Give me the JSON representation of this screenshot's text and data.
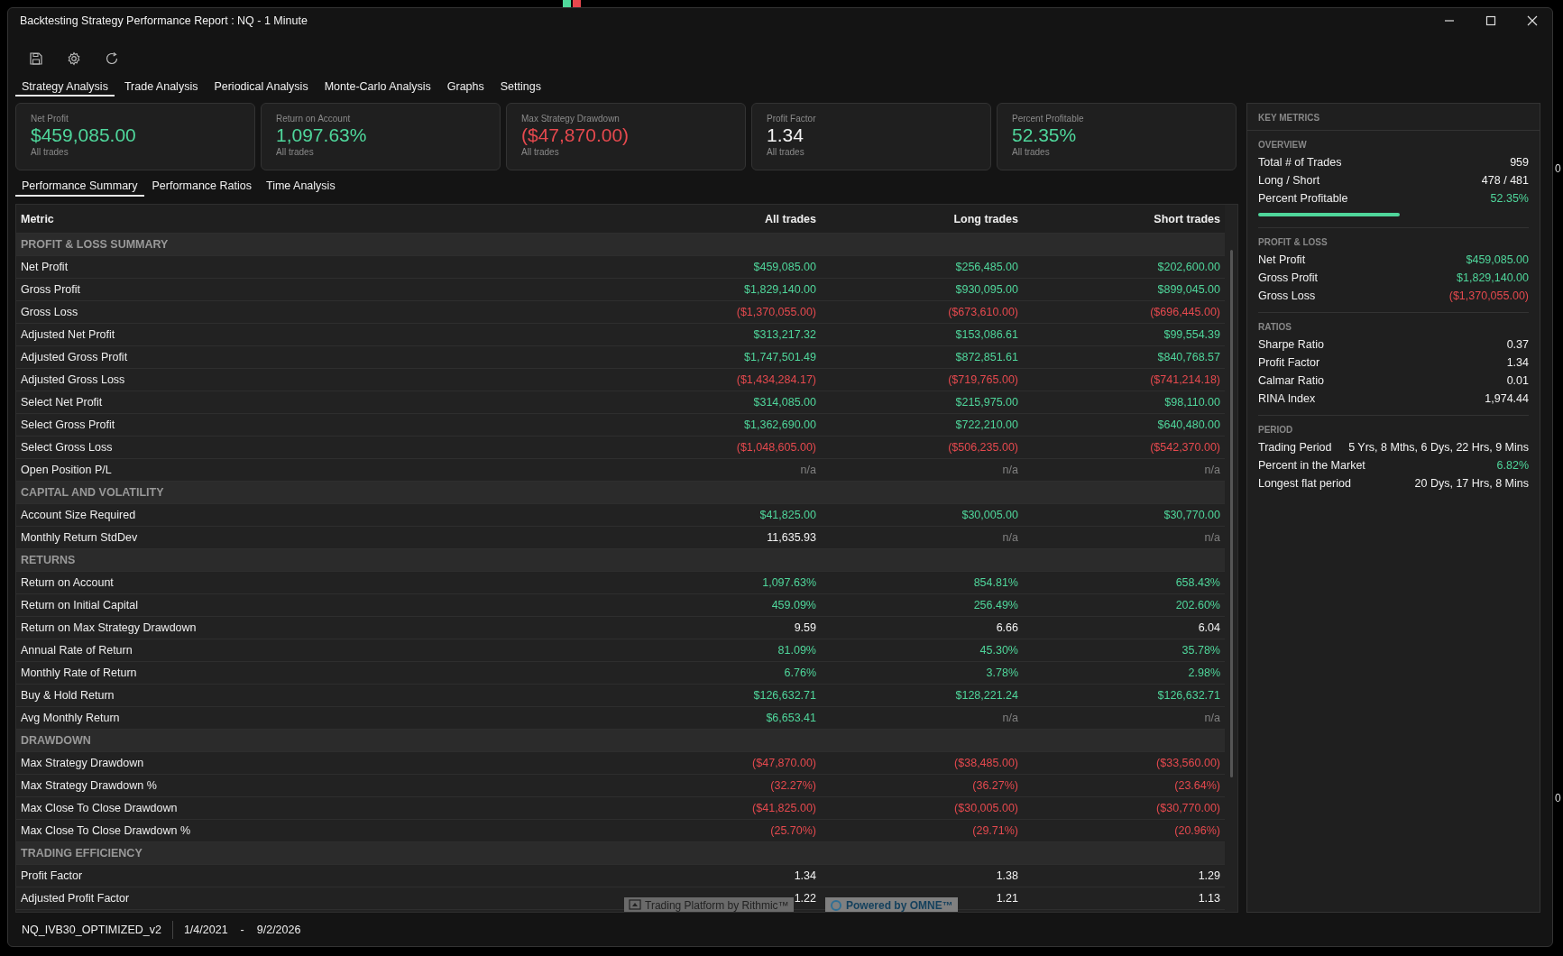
{
  "window": {
    "title": "Backtesting Strategy Performance Report : NQ - 1 Minute"
  },
  "tabs": [
    {
      "label": "Strategy Analysis",
      "selected": true
    },
    {
      "label": "Trade Analysis",
      "selected": false
    },
    {
      "label": "Periodical Analysis",
      "selected": false
    },
    {
      "label": "Monte-Carlo Analysis",
      "selected": false
    },
    {
      "label": "Graphs",
      "selected": false
    },
    {
      "label": "Settings",
      "selected": false
    }
  ],
  "cards": [
    {
      "label": "Net Profit",
      "value": "$459,085.00",
      "color": "#4fd69b",
      "note": "All trades"
    },
    {
      "label": "Return on Account",
      "value": "1,097.63%",
      "color": "#4fd69b",
      "note": "All trades"
    },
    {
      "label": "Max Strategy Drawdown",
      "value": "($47,870.00)",
      "color": "#e5494e",
      "note": "All trades"
    },
    {
      "label": "Profit Factor",
      "value": "1.34",
      "color": "#f2f2f2",
      "note": "All trades"
    },
    {
      "label": "Percent Profitable",
      "value": "52.35%",
      "color": "#4fd69b",
      "note": "All trades"
    }
  ],
  "subtabs": [
    {
      "label": "Performance Summary",
      "selected": true
    },
    {
      "label": "Performance Ratios",
      "selected": false
    },
    {
      "label": "Time Analysis",
      "selected": false
    }
  ],
  "table": {
    "columns": [
      "Metric",
      "All trades",
      "Long trades",
      "Short trades"
    ],
    "rows": [
      {
        "kind": "section",
        "label": "PROFIT & LOSS SUMMARY"
      },
      {
        "kind": "metric",
        "label": "Net Profit",
        "cells": [
          {
            "text": "$459,085.00",
            "color": "#4fd69b"
          },
          {
            "text": "$256,485.00",
            "color": "#4fd69b"
          },
          {
            "text": "$202,600.00",
            "color": "#4fd69b"
          }
        ]
      },
      {
        "kind": "metric",
        "label": "Gross Profit",
        "cells": [
          {
            "text": "$1,829,140.00",
            "color": "#4fd69b"
          },
          {
            "text": "$930,095.00",
            "color": "#4fd69b"
          },
          {
            "text": "$899,045.00",
            "color": "#4fd69b"
          }
        ]
      },
      {
        "kind": "metric",
        "label": "Gross Loss",
        "cells": [
          {
            "text": "($1,370,055.00)",
            "color": "#e5494e"
          },
          {
            "text": "($673,610.00)",
            "color": "#e5494e"
          },
          {
            "text": "($696,445.00)",
            "color": "#e5494e"
          }
        ]
      },
      {
        "kind": "metric",
        "label": "Adjusted Net Profit",
        "cells": [
          {
            "text": "$313,217.32",
            "color": "#4fd69b"
          },
          {
            "text": "$153,086.61",
            "color": "#4fd69b"
          },
          {
            "text": "$99,554.39",
            "color": "#4fd69b"
          }
        ]
      },
      {
        "kind": "metric",
        "label": "Adjusted Gross Profit",
        "cells": [
          {
            "text": "$1,747,501.49",
            "color": "#4fd69b"
          },
          {
            "text": "$872,851.61",
            "color": "#4fd69b"
          },
          {
            "text": "$840,768.57",
            "color": "#4fd69b"
          }
        ]
      },
      {
        "kind": "metric",
        "label": "Adjusted Gross Loss",
        "cells": [
          {
            "text": "($1,434,284.17)",
            "color": "#e5494e"
          },
          {
            "text": "($719,765.00)",
            "color": "#e5494e"
          },
          {
            "text": "($741,214.18)",
            "color": "#e5494e"
          }
        ]
      },
      {
        "kind": "metric",
        "label": "Select Net Profit",
        "cells": [
          {
            "text": "$314,085.00",
            "color": "#4fd69b"
          },
          {
            "text": "$215,975.00",
            "color": "#4fd69b"
          },
          {
            "text": "$98,110.00",
            "color": "#4fd69b"
          }
        ]
      },
      {
        "kind": "metric",
        "label": "Select Gross Profit",
        "cells": [
          {
            "text": "$1,362,690.00",
            "color": "#4fd69b"
          },
          {
            "text": "$722,210.00",
            "color": "#4fd69b"
          },
          {
            "text": "$640,480.00",
            "color": "#4fd69b"
          }
        ]
      },
      {
        "kind": "metric",
        "label": "Select Gross Loss",
        "cells": [
          {
            "text": "($1,048,605.00)",
            "color": "#e5494e"
          },
          {
            "text": "($506,235.00)",
            "color": "#e5494e"
          },
          {
            "text": "($542,370.00)",
            "color": "#e5494e"
          }
        ]
      },
      {
        "kind": "metric",
        "label": "Open Position P/L",
        "cells": [
          {
            "text": "n/a",
            "color": "#808080"
          },
          {
            "text": "n/a",
            "color": "#808080"
          },
          {
            "text": "n/a",
            "color": "#808080"
          }
        ]
      },
      {
        "kind": "section",
        "label": "CAPITAL AND VOLATILITY"
      },
      {
        "kind": "metric",
        "label": "Account Size Required",
        "cells": [
          {
            "text": "$41,825.00",
            "color": "#4fd69b"
          },
          {
            "text": "$30,005.00",
            "color": "#4fd69b"
          },
          {
            "text": "$30,770.00",
            "color": "#4fd69b"
          }
        ]
      },
      {
        "kind": "metric",
        "label": "Monthly Return StdDev",
        "cells": [
          {
            "text": "11,635.93",
            "color": "#f2f2f2"
          },
          {
            "text": "n/a",
            "color": "#808080"
          },
          {
            "text": "n/a",
            "color": "#808080"
          }
        ]
      },
      {
        "kind": "section",
        "label": "RETURNS"
      },
      {
        "kind": "metric",
        "label": "Return on Account",
        "cells": [
          {
            "text": "1,097.63%",
            "color": "#4fd69b"
          },
          {
            "text": "854.81%",
            "color": "#4fd69b"
          },
          {
            "text": "658.43%",
            "color": "#4fd69b"
          }
        ]
      },
      {
        "kind": "metric",
        "label": "Return on Initial Capital",
        "cells": [
          {
            "text": "459.09%",
            "color": "#4fd69b"
          },
          {
            "text": "256.49%",
            "color": "#4fd69b"
          },
          {
            "text": "202.60%",
            "color": "#4fd69b"
          }
        ]
      },
      {
        "kind": "metric",
        "label": "Return on Max Strategy Drawdown",
        "cells": [
          {
            "text": "9.59",
            "color": "#f2f2f2"
          },
          {
            "text": "6.66",
            "color": "#f2f2f2"
          },
          {
            "text": "6.04",
            "color": "#f2f2f2"
          }
        ]
      },
      {
        "kind": "metric",
        "label": "Annual Rate of Return",
        "cells": [
          {
            "text": "81.09%",
            "color": "#4fd69b"
          },
          {
            "text": "45.30%",
            "color": "#4fd69b"
          },
          {
            "text": "35.78%",
            "color": "#4fd69b"
          }
        ]
      },
      {
        "kind": "metric",
        "label": "Monthly Rate of Return",
        "cells": [
          {
            "text": "6.76%",
            "color": "#4fd69b"
          },
          {
            "text": "3.78%",
            "color": "#4fd69b"
          },
          {
            "text": "2.98%",
            "color": "#4fd69b"
          }
        ]
      },
      {
        "kind": "metric",
        "label": "Buy & Hold Return",
        "cells": [
          {
            "text": "$126,632.71",
            "color": "#4fd69b"
          },
          {
            "text": "$128,221.24",
            "color": "#4fd69b"
          },
          {
            "text": "$126,632.71",
            "color": "#4fd69b"
          }
        ]
      },
      {
        "kind": "metric",
        "label": "Avg Monthly Return",
        "cells": [
          {
            "text": "$6,653.41",
            "color": "#4fd69b"
          },
          {
            "text": "n/a",
            "color": "#808080"
          },
          {
            "text": "n/a",
            "color": "#808080"
          }
        ]
      },
      {
        "kind": "section",
        "label": "DRAWDOWN"
      },
      {
        "kind": "metric",
        "label": "Max Strategy Drawdown",
        "cells": [
          {
            "text": "($47,870.00)",
            "color": "#e5494e"
          },
          {
            "text": "($38,485.00)",
            "color": "#e5494e"
          },
          {
            "text": "($33,560.00)",
            "color": "#e5494e"
          }
        ]
      },
      {
        "kind": "metric",
        "label": "Max Strategy Drawdown %",
        "cells": [
          {
            "text": "(32.27%)",
            "color": "#e5494e"
          },
          {
            "text": "(36.27%)",
            "color": "#e5494e"
          },
          {
            "text": "(23.64%)",
            "color": "#e5494e"
          }
        ]
      },
      {
        "kind": "metric",
        "label": "Max Close To Close Drawdown",
        "cells": [
          {
            "text": "($41,825.00)",
            "color": "#e5494e"
          },
          {
            "text": "($30,005.00)",
            "color": "#e5494e"
          },
          {
            "text": "($30,770.00)",
            "color": "#e5494e"
          }
        ]
      },
      {
        "kind": "metric",
        "label": "Max Close To Close Drawdown %",
        "cells": [
          {
            "text": "(25.70%)",
            "color": "#e5494e"
          },
          {
            "text": "(29.71%)",
            "color": "#e5494e"
          },
          {
            "text": "(20.96%)",
            "color": "#e5494e"
          }
        ]
      },
      {
        "kind": "section",
        "label": "TRADING EFFICIENCY"
      },
      {
        "kind": "metric",
        "label": "Profit Factor",
        "cells": [
          {
            "text": "1.34",
            "color": "#f2f2f2"
          },
          {
            "text": "1.38",
            "color": "#f2f2f2"
          },
          {
            "text": "1.29",
            "color": "#f2f2f2"
          }
        ]
      },
      {
        "kind": "metric",
        "label": "Adjusted Profit Factor",
        "cells": [
          {
            "text": "1.22",
            "color": "#f2f2f2"
          },
          {
            "text": "1.21",
            "color": "#f2f2f2"
          },
          {
            "text": "1.13",
            "color": "#f2f2f2"
          }
        ]
      }
    ]
  },
  "branding": [
    "Trading Platform by Rithmic™",
    "Powered by OMNE™"
  ],
  "key_metrics": {
    "title": "KEY METRICS",
    "sections": [
      {
        "title": "OVERVIEW",
        "items": [
          {
            "label": "Total # of Trades",
            "value": "959",
            "color": "#f2f2f2"
          },
          {
            "label": "Long / Short",
            "value": "478 / 481",
            "color": "#f2f2f2"
          },
          {
            "label": "Percent Profitable",
            "value": "52.35%",
            "color": "#4fd69b",
            "level": 0.5235
          }
        ]
      },
      {
        "title": "PROFIT & LOSS",
        "items": [
          {
            "label": "Net Profit",
            "value": "$459,085.00",
            "color": "#4fd69b"
          },
          {
            "label": "Gross Profit",
            "value": "$1,829,140.00",
            "color": "#4fd69b"
          },
          {
            "label": "Gross Loss",
            "value": "($1,370,055.00)",
            "color": "#e5494e"
          }
        ]
      },
      {
        "title": "RATIOS",
        "items": [
          {
            "label": "Sharpe Ratio",
            "value": "0.37",
            "color": "#f2f2f2"
          },
          {
            "label": "Profit Factor",
            "value": "1.34",
            "color": "#f2f2f2"
          },
          {
            "label": "Calmar Ratio",
            "value": "0.01",
            "color": "#f2f2f2"
          },
          {
            "label": "RINA Index",
            "value": "1,974.44",
            "color": "#f2f2f2"
          }
        ]
      },
      {
        "title": "PERIOD",
        "items": [
          {
            "label": "Trading Period",
            "value": "5 Yrs, 8 Mths, 6 Dys, 22 Hrs, 9 Mins",
            "color": "#f2f2f2"
          },
          {
            "label": "Percent in the Market",
            "value": "6.82%",
            "color": "#4fd69b"
          },
          {
            "label": "Longest flat period",
            "value": "20 Dys, 17 Hrs, 8 Mins",
            "color": "#f2f2f2"
          }
        ]
      }
    ]
  },
  "status_bar": {
    "strategy": "NQ_IVB30_OPTIMIZED_v2",
    "start": "1/4/2021",
    "separator": "-",
    "end": "9/2/2026"
  },
  "background_chart": {
    "price_labels": [
      "0",
      "0"
    ]
  }
}
